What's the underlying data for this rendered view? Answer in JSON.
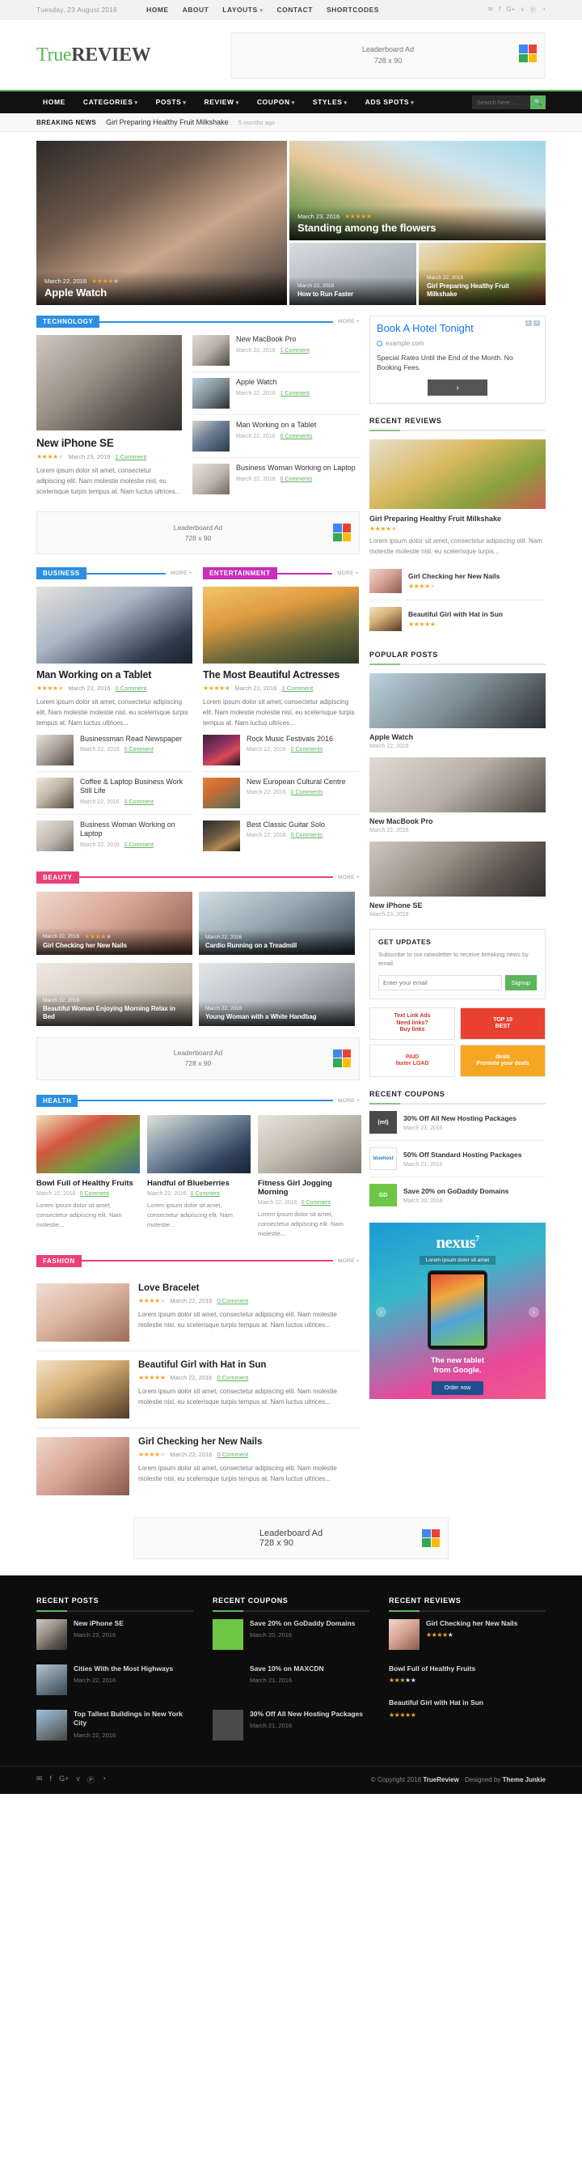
{
  "topbar": {
    "date": "Tuesday, 23 August 2016",
    "nav": [
      {
        "label": "HOME",
        "caret": ""
      },
      {
        "label": "ABOUT",
        "caret": ""
      },
      {
        "label": "LAYOUTS",
        "caret": "▾"
      },
      {
        "label": "CONTACT",
        "caret": ""
      },
      {
        "label": "SHORTCODES",
        "caret": ""
      }
    ],
    "social": [
      "twitter-icon",
      "facebook-icon",
      "google-plus-icon",
      "vimeo-icon",
      "pinterest-icon",
      "rss-icon"
    ]
  },
  "header": {
    "logo_green": "True",
    "logo_dark": "REVIEW",
    "ad_line1": "Leaderboard Ad",
    "ad_line2": "728 x 90"
  },
  "nav": {
    "items": [
      {
        "label": "HOME",
        "caret": ""
      },
      {
        "label": "CATEGORIES",
        "caret": "▾"
      },
      {
        "label": "POSTS",
        "caret": "▾"
      },
      {
        "label": "REVIEW",
        "caret": "▾"
      },
      {
        "label": "COUPON",
        "caret": "▾"
      },
      {
        "label": "STYLES",
        "caret": "▾"
      },
      {
        "label": "ADS SPOTS",
        "caret": "▾"
      }
    ],
    "search_placeholder": "Search here ...",
    "search_value": ""
  },
  "breaking": {
    "label": "BREAKING NEWS",
    "title": "Girl Preparing Healthy Fruit Milkshake",
    "time": "5 months ago"
  },
  "hero": {
    "main": {
      "date": "March 22, 2016",
      "stars": 4,
      "title": "Apple Watch",
      "img": "i-watch"
    },
    "top": {
      "date": "March 23, 2016",
      "stars": 5,
      "title": "Standing among the flowers",
      "img": "i-fence"
    },
    "small": [
      {
        "date": "March 22, 2016",
        "title": "How to Run Faster",
        "img": "i-run"
      },
      {
        "date": "March 22, 2016",
        "title": "Girl Preparing Healthy Fruit Milkshake",
        "img": "i-milk"
      }
    ]
  },
  "technology": {
    "tag": "TECHNOLOGY",
    "color": "#2d8fe0",
    "more": "MORE +",
    "feature": {
      "img": "i-phone",
      "title": "New iPhone SE",
      "stars": 4,
      "date": "March 23, 2016",
      "comments": "1 Comment",
      "excerpt": "Lorem ipsum dolor sit amet, consectetur adipiscing elit. Nam molestie molestie nisl, eu scelerisque turpis tempus at. Nam luctus ultrices..."
    },
    "list": [
      {
        "img": "i-mbp",
        "title": "New MacBook Pro",
        "date": "March 22, 2016",
        "comments": "1 Comment"
      },
      {
        "img": "i-wrist",
        "title": "Apple Watch",
        "date": "March 22, 2016",
        "comments": "1 Comment"
      },
      {
        "img": "i-tablet",
        "title": "Man Working on a Tablet",
        "date": "March 22, 2016",
        "comments": "0 Comments"
      },
      {
        "img": "i-bizw",
        "title": "Business Woman Working on Laptop",
        "date": "March 22, 2016",
        "comments": "0 Comments"
      }
    ]
  },
  "inline_ad": {
    "line1": "Leaderboard Ad",
    "line2": "728 x 90"
  },
  "business": {
    "tag": "BUSINESS",
    "color": "#2d8fe0",
    "more": "MORE +",
    "feature": {
      "img": "i-man",
      "title": "Man Working on a Tablet",
      "stars": 4.5,
      "date": "March 22, 2016",
      "comments": "0 Comment",
      "excerpt": "Lorem ipsum dolor sit amet, consectetur adipiscing elit. Nam molestie molestie nisl, eu scelerisque turpis tempus at. Nam luctus ultrices..."
    },
    "list": [
      {
        "img": "i-news",
        "title": "Businessman Read Newspaper",
        "date": "March 22, 2016",
        "comments": "0 Comment"
      },
      {
        "img": "i-coffee",
        "title": "Coffee & Laptop Business Work Still Life",
        "date": "March 22, 2016",
        "comments": "0 Comment"
      },
      {
        "img": "i-bizw",
        "title": "Business Woman Working on Laptop",
        "date": "March 22, 2016",
        "comments": "0 Comment"
      }
    ]
  },
  "entertainment": {
    "tag": "ENTERTAINMENT",
    "color": "#c730b8",
    "more": "MORE +",
    "feature": {
      "img": "i-actr",
      "title": "The Most Beautiful Actresses",
      "stars": 5,
      "date": "March 22, 2016",
      "comments": "1 Comment",
      "excerpt": "Lorem ipsum dolor sit amet, consectetur adipiscing elit. Nam molestie molestie nisl, eu scelerisque turpis tempus at. Nam luctus ultrices..."
    },
    "list": [
      {
        "img": "i-rock",
        "title": "Rock Music Festivals 2016",
        "date": "March 22, 2016",
        "comments": "0 Comments"
      },
      {
        "img": "i-euro",
        "title": "New European Cultural Centre",
        "date": "March 22, 2016",
        "comments": "0 Comments"
      },
      {
        "img": "i-guitar",
        "title": "Best Classic Guitar Solo",
        "date": "March 22, 2016",
        "comments": "0 Comments"
      }
    ]
  },
  "beauty": {
    "tag": "BEAUTY",
    "color": "#e8417a",
    "more": "MORE +",
    "cells": [
      {
        "img": "i-nails",
        "date": "March 22, 2016",
        "stars": 4,
        "title": "Girl Checking her New Nails"
      },
      {
        "img": "i-tread",
        "date": "March 22, 2016",
        "stars": 0,
        "title": "Cardio Running on a Treadmill"
      },
      {
        "img": "i-bed",
        "date": "March 22, 2016",
        "stars": 0,
        "title": "Beautiful Woman Enjoying Morning Relax in Bed"
      },
      {
        "img": "i-hand",
        "date": "March 22, 2016",
        "stars": 0,
        "title": "Young Woman with a White Handbag"
      }
    ]
  },
  "health": {
    "tag": "HEALTH",
    "color": "#2d8fe0",
    "more": "MORE +",
    "cells": [
      {
        "img": "i-fruits",
        "title": "Bowl Full of Healthy Fruits",
        "date": "March 22, 2016",
        "comments": "0 Comment",
        "excerpt": "Lorem ipsum dolor sit amet, consectetur adipiscing elit. Nam molestie..."
      },
      {
        "img": "i-berry",
        "title": "Handful of Blueberries",
        "date": "March 22, 2016",
        "comments": "0 Comment",
        "excerpt": "Lorem ipsum dolor sit amet, consectetur adipiscing elit. Nam molestie..."
      },
      {
        "img": "i-jog",
        "title": "Fitness Girl Jogging Morning",
        "date": "March 22, 2016",
        "comments": "0 Comment",
        "excerpt": "Lorem ipsum dolor sit amet, consectetur adipiscing elit. Nam molestie..."
      }
    ]
  },
  "fashion": {
    "tag": "FASHION",
    "color": "#e8417a",
    "more": "MORE +",
    "rows": [
      {
        "img": "i-brace",
        "title": "Love Bracelet",
        "stars": 4,
        "date": "March 22, 2016",
        "comments": "0 Comment",
        "excerpt": "Lorem ipsum dolor sit amet, consectetur adipiscing elit. Nam molestie molestie nisl, eu scelerisque turpis tempus at. Nam luctus ultrices..."
      },
      {
        "img": "i-hat",
        "title": "Beautiful Girl with Hat in Sun",
        "stars": 5,
        "date": "March 22, 2016",
        "comments": "0 Comment",
        "excerpt": "Lorem ipsum dolor sit amet, consectetur adipiscing elit. Nam molestie molestie nisl, eu scelerisque turpis tempus at. Nam luctus ultrices..."
      },
      {
        "img": "i-nails",
        "title": "Girl Checking her New Nails",
        "stars": 4,
        "date": "March 22, 2016",
        "comments": "0 Comment",
        "excerpt": "Lorem ipsum dolor sit amet, consectetur adipiscing elit. Nam molestie molestie nisl, eu scelerisque turpis tempus at. Nam luctus ultrices..."
      }
    ]
  },
  "sidebar": {
    "ad": {
      "title": "Book A Hotel Tonight",
      "url": "example.com",
      "body": "Special Rates Until the End of the Month. No Booking Fees.",
      "button": "›"
    },
    "recent_reviews_title": "RECENT REVIEWS",
    "recent_reviews_big": {
      "img": "i-milk",
      "title": "Girl Preparing Healthy Fruit Milkshake",
      "stars": 4.5,
      "excerpt": "Lorem ipsum dolor sit amet, consectetur adipiscing elit. Nam molestie molestie nisl, eu scelerisque turpis..."
    },
    "recent_reviews_rows": [
      {
        "img": "i-nails",
        "title": "Girl Checking her New Nails",
        "stars": 4
      },
      {
        "img": "i-hat",
        "title": "Beautiful Girl with Hat in Sun",
        "stars": 5
      }
    ],
    "popular_title": "POPULAR POSTS",
    "popular": [
      {
        "img": "i-wrist",
        "title": "Apple Watch",
        "date": "March 22, 2016"
      },
      {
        "img": "i-mbp",
        "title": "New MacBook Pro",
        "date": "March 22, 2016"
      },
      {
        "img": "i-phone",
        "title": "New iPhone SE",
        "date": "March 23, 2016"
      }
    ],
    "get_updates": {
      "title": "GET UPDATES",
      "body": "Subscribe to our newsletter to receive breaking news by email.",
      "placeholder": "Enter your email",
      "value": "",
      "button": "Signup"
    },
    "badges": [
      {
        "cls": "b1",
        "text": "Text Link Ads\nNeed links?\nBuy links"
      },
      {
        "cls": "b2",
        "text": "TOP 10\nBEST"
      },
      {
        "cls": "b3",
        "text": "PAID\nfaster LOAD"
      },
      {
        "cls": "b4",
        "text": "deals\nPromote your deals"
      }
    ],
    "coupons_title": "RECENT COUPONS",
    "coupons": [
      {
        "logo": "lg-mt",
        "logo_text": "(mt)",
        "title": "30% Off All New Hosting Packages",
        "date": "March 21, 2016"
      },
      {
        "logo": "lg-bh",
        "logo_text": "bluehost",
        "title": "50% Off Standard Hosting Packages",
        "date": "March 21, 2016"
      },
      {
        "logo": "lg-gd",
        "logo_text": "GD",
        "title": "Save 20% on GoDaddy Domains",
        "date": "March 20, 2016"
      }
    ],
    "nexus": {
      "brand": "nexus",
      "sup": "7",
      "sub": "Lorem ipsum dolor sit amet",
      "tagline": "The new tablet\nfrom Google.",
      "button": "Order now"
    }
  },
  "bottom_ad": {
    "line1": "Leaderboard Ad",
    "line2": "728 x 90"
  },
  "footer": {
    "cols": [
      {
        "title": "RECENT POSTS",
        "rows": [
          {
            "img": "i-phone",
            "title": "New iPhone SE",
            "meta": "March 23, 2016"
          },
          {
            "img": "i-city",
            "title": "Cities With the Most Highways",
            "meta": "March 22, 2016"
          },
          {
            "img": "i-bldg",
            "title": "Top Tallest Buildings in New York City",
            "meta": "March 22, 2016"
          }
        ]
      },
      {
        "title": "RECENT COUPONS",
        "rows": [
          {
            "img": "lg-gd",
            "title": "Save 20% on GoDaddy Domains",
            "meta": "March 20, 2016"
          },
          {
            "img": "lg-mx",
            "title": "Save 10% on MAXCDN",
            "meta": "March 21, 2016"
          },
          {
            "img": "lg-mt",
            "title": "30% Off All New Hosting Packages",
            "meta": "March 21, 2016"
          }
        ]
      },
      {
        "title": "RECENT REVIEWS",
        "rows": [
          {
            "img": "i-nails",
            "title": "Girl Checking her New Nails",
            "stars": 4
          },
          {
            "img": "",
            "title": "Bowl Full of Healthy Fruits",
            "stars": 3
          },
          {
            "img": "",
            "title": "Beautiful Girl with Hat in Sun",
            "stars": 5
          }
        ]
      }
    ],
    "social": [
      "twitter-icon",
      "facebook-icon",
      "google-plus-icon",
      "vimeo-icon",
      "pinterest-icon",
      "rss-icon"
    ],
    "copyright_pre": "© Copyright 2016 ",
    "copyright_brand": "TrueReview",
    "copyright_mid": " · Designed by ",
    "copyright_designer": "Theme Junkie"
  }
}
